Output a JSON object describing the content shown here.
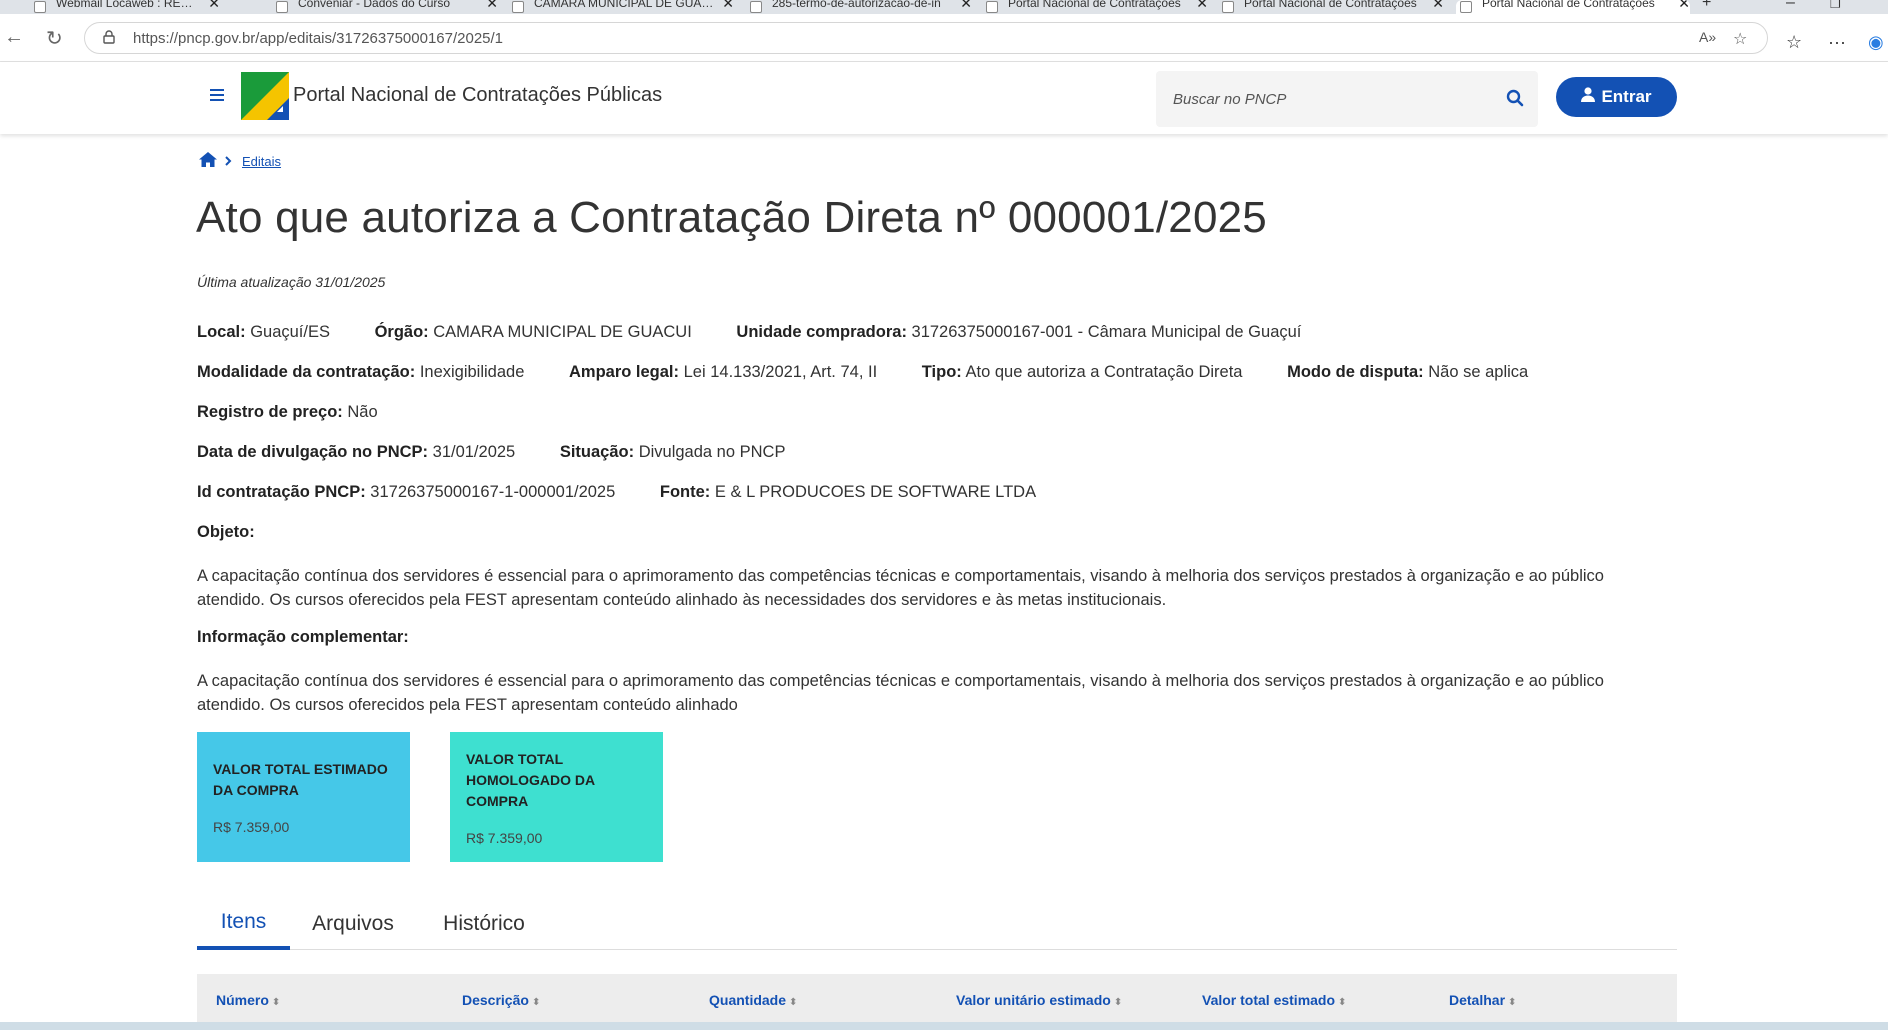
{
  "browser": {
    "tabs": [
      {
        "title": "Webmail Locaweb : RES: RES: A/C"
      },
      {
        "title": "Conveniar - Dados do Curso"
      },
      {
        "title": "CAMARA MUNICIPAL DE GUAÇUÍ"
      },
      {
        "title": "285-termo-de-autorizacao-de-in"
      },
      {
        "title": "Portal Nacional de Contratações"
      },
      {
        "title": "Portal Nacional de Contratações"
      },
      {
        "title": "Portal Nacional de Contratações"
      }
    ],
    "url": "https://pncp.gov.br/app/editais/31726375000167/2025/1"
  },
  "header": {
    "site_title": "Portal Nacional de Contratações Públicas",
    "search_placeholder": "Buscar no PNCP",
    "login_label": "Entrar"
  },
  "breadcrumb": {
    "current": "Editais"
  },
  "page": {
    "title": "Ato que autoriza a Contratação Direta nº 000001/2025",
    "updated": "Última atualização 31/01/2025"
  },
  "fields": {
    "local": {
      "label": "Local:",
      "value": "Guaçuí/ES"
    },
    "orgao": {
      "label": "Órgão:",
      "value": "CAMARA MUNICIPAL DE GUACUI"
    },
    "unidade": {
      "label": "Unidade compradora:",
      "value": "31726375000167-001 - Câmara Municipal de Guaçuí"
    },
    "modalidade": {
      "label": "Modalidade da contratação:",
      "value": "Inexigibilidade"
    },
    "amparo": {
      "label": "Amparo legal:",
      "value": "Lei 14.133/2021, Art. 74, II"
    },
    "tipo": {
      "label": "Tipo:",
      "value": "Ato que autoriza a Contratação Direta"
    },
    "modo": {
      "label": "Modo de disputa:",
      "value": "Não se aplica"
    },
    "registro": {
      "label": "Registro de preço:",
      "value": "Não"
    },
    "data": {
      "label": "Data de divulgação no PNCP:",
      "value": "31/01/2025"
    },
    "situacao": {
      "label": "Situação:",
      "value": "Divulgada no PNCP"
    },
    "id": {
      "label": "Id contratação PNCP:",
      "value": "31726375000167-1-000001/2025"
    },
    "fonte": {
      "label": "Fonte:",
      "value": "E & L PRODUCOES DE SOFTWARE LTDA"
    }
  },
  "objeto": {
    "label": "Objeto:",
    "text": "A capacitação contínua dos servidores é essencial para o aprimoramento das competências técnicas e comportamentais, visando à melhoria dos serviços prestados à organização e ao público atendido. Os cursos oferecidos pela FEST apresentam conteúdo alinhado às necessidades dos servidores e às metas institucionais."
  },
  "complementar": {
    "label": "Informação complementar:",
    "text": "A capacitação contínua dos servidores é essencial para o aprimoramento das competências técnicas e comportamentais, visando à melhoria dos serviços prestados à organização e ao público atendido. Os cursos oferecidos pela FEST apresentam conteúdo alinhado"
  },
  "cards": [
    {
      "title": "VALOR TOTAL ESTIMADO DA COMPRA",
      "value": "R$ 7.359,00",
      "color": "#45c8e8"
    },
    {
      "title": "VALOR TOTAL HOMOLOGADO DA COMPRA",
      "value": "R$ 7.359,00",
      "color": "#3ee0d0"
    }
  ],
  "tabs": {
    "itens": "Itens",
    "arquivos": "Arquivos",
    "historico": "Histórico"
  },
  "table": {
    "headers": [
      "Número",
      "Descrição",
      "Quantidade",
      "Valor unitário estimado",
      "Valor total estimado",
      "Detalhar"
    ]
  },
  "colors": {
    "primary": "#1351b4"
  }
}
